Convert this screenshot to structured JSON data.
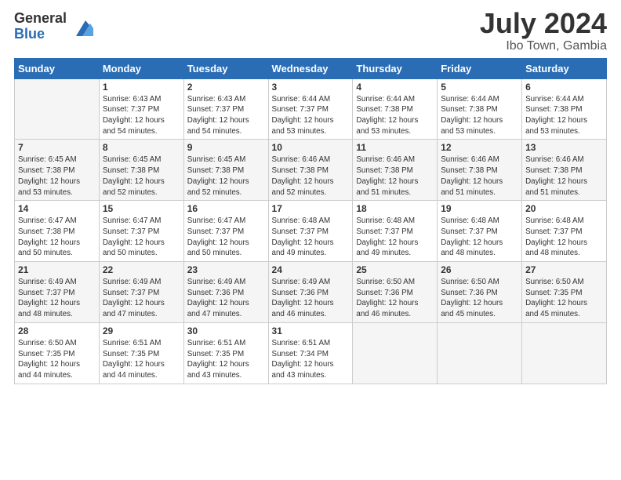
{
  "logo": {
    "general": "General",
    "blue": "Blue"
  },
  "header": {
    "month": "July 2024",
    "location": "Ibo Town, Gambia"
  },
  "weekdays": [
    "Sunday",
    "Monday",
    "Tuesday",
    "Wednesday",
    "Thursday",
    "Friday",
    "Saturday"
  ],
  "weeks": [
    [
      {
        "day": "",
        "info": ""
      },
      {
        "day": "1",
        "info": "Sunrise: 6:43 AM\nSunset: 7:37 PM\nDaylight: 12 hours\nand 54 minutes."
      },
      {
        "day": "2",
        "info": "Sunrise: 6:43 AM\nSunset: 7:37 PM\nDaylight: 12 hours\nand 54 minutes."
      },
      {
        "day": "3",
        "info": "Sunrise: 6:44 AM\nSunset: 7:37 PM\nDaylight: 12 hours\nand 53 minutes."
      },
      {
        "day": "4",
        "info": "Sunrise: 6:44 AM\nSunset: 7:38 PM\nDaylight: 12 hours\nand 53 minutes."
      },
      {
        "day": "5",
        "info": "Sunrise: 6:44 AM\nSunset: 7:38 PM\nDaylight: 12 hours\nand 53 minutes."
      },
      {
        "day": "6",
        "info": "Sunrise: 6:44 AM\nSunset: 7:38 PM\nDaylight: 12 hours\nand 53 minutes."
      }
    ],
    [
      {
        "day": "7",
        "info": "Sunrise: 6:45 AM\nSunset: 7:38 PM\nDaylight: 12 hours\nand 53 minutes."
      },
      {
        "day": "8",
        "info": "Sunrise: 6:45 AM\nSunset: 7:38 PM\nDaylight: 12 hours\nand 52 minutes."
      },
      {
        "day": "9",
        "info": "Sunrise: 6:45 AM\nSunset: 7:38 PM\nDaylight: 12 hours\nand 52 minutes."
      },
      {
        "day": "10",
        "info": "Sunrise: 6:46 AM\nSunset: 7:38 PM\nDaylight: 12 hours\nand 52 minutes."
      },
      {
        "day": "11",
        "info": "Sunrise: 6:46 AM\nSunset: 7:38 PM\nDaylight: 12 hours\nand 51 minutes."
      },
      {
        "day": "12",
        "info": "Sunrise: 6:46 AM\nSunset: 7:38 PM\nDaylight: 12 hours\nand 51 minutes."
      },
      {
        "day": "13",
        "info": "Sunrise: 6:46 AM\nSunset: 7:38 PM\nDaylight: 12 hours\nand 51 minutes."
      }
    ],
    [
      {
        "day": "14",
        "info": "Sunrise: 6:47 AM\nSunset: 7:38 PM\nDaylight: 12 hours\nand 50 minutes."
      },
      {
        "day": "15",
        "info": "Sunrise: 6:47 AM\nSunset: 7:37 PM\nDaylight: 12 hours\nand 50 minutes."
      },
      {
        "day": "16",
        "info": "Sunrise: 6:47 AM\nSunset: 7:37 PM\nDaylight: 12 hours\nand 50 minutes."
      },
      {
        "day": "17",
        "info": "Sunrise: 6:48 AM\nSunset: 7:37 PM\nDaylight: 12 hours\nand 49 minutes."
      },
      {
        "day": "18",
        "info": "Sunrise: 6:48 AM\nSunset: 7:37 PM\nDaylight: 12 hours\nand 49 minutes."
      },
      {
        "day": "19",
        "info": "Sunrise: 6:48 AM\nSunset: 7:37 PM\nDaylight: 12 hours\nand 48 minutes."
      },
      {
        "day": "20",
        "info": "Sunrise: 6:48 AM\nSunset: 7:37 PM\nDaylight: 12 hours\nand 48 minutes."
      }
    ],
    [
      {
        "day": "21",
        "info": "Sunrise: 6:49 AM\nSunset: 7:37 PM\nDaylight: 12 hours\nand 48 minutes."
      },
      {
        "day": "22",
        "info": "Sunrise: 6:49 AM\nSunset: 7:37 PM\nDaylight: 12 hours\nand 47 minutes."
      },
      {
        "day": "23",
        "info": "Sunrise: 6:49 AM\nSunset: 7:36 PM\nDaylight: 12 hours\nand 47 minutes."
      },
      {
        "day": "24",
        "info": "Sunrise: 6:49 AM\nSunset: 7:36 PM\nDaylight: 12 hours\nand 46 minutes."
      },
      {
        "day": "25",
        "info": "Sunrise: 6:50 AM\nSunset: 7:36 PM\nDaylight: 12 hours\nand 46 minutes."
      },
      {
        "day": "26",
        "info": "Sunrise: 6:50 AM\nSunset: 7:36 PM\nDaylight: 12 hours\nand 45 minutes."
      },
      {
        "day": "27",
        "info": "Sunrise: 6:50 AM\nSunset: 7:35 PM\nDaylight: 12 hours\nand 45 minutes."
      }
    ],
    [
      {
        "day": "28",
        "info": "Sunrise: 6:50 AM\nSunset: 7:35 PM\nDaylight: 12 hours\nand 44 minutes."
      },
      {
        "day": "29",
        "info": "Sunrise: 6:51 AM\nSunset: 7:35 PM\nDaylight: 12 hours\nand 44 minutes."
      },
      {
        "day": "30",
        "info": "Sunrise: 6:51 AM\nSunset: 7:35 PM\nDaylight: 12 hours\nand 43 minutes."
      },
      {
        "day": "31",
        "info": "Sunrise: 6:51 AM\nSunset: 7:34 PM\nDaylight: 12 hours\nand 43 minutes."
      },
      {
        "day": "",
        "info": ""
      },
      {
        "day": "",
        "info": ""
      },
      {
        "day": "",
        "info": ""
      }
    ]
  ]
}
